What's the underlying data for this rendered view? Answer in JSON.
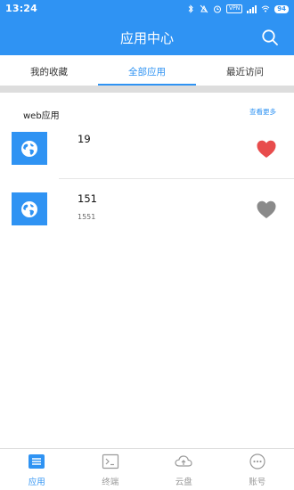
{
  "status_bar": {
    "time": "13:24",
    "vpn": "VPN",
    "battery": "94"
  },
  "header": {
    "title": "应用中心",
    "search_icon": "search-icon"
  },
  "tabs": [
    {
      "label": "我的收藏",
      "active": false
    },
    {
      "label": "全部应用",
      "active": true
    },
    {
      "label": "最近访问",
      "active": false
    }
  ],
  "section": {
    "title": "web应用",
    "more_label": "查看更多"
  },
  "apps": [
    {
      "name": "19",
      "subtitle": "",
      "icon": "globe-icon",
      "favorited": true
    },
    {
      "name": "151",
      "subtitle": "1551",
      "icon": "globe-icon",
      "favorited": false
    }
  ],
  "bottom_nav": [
    {
      "label": "应用",
      "icon": "apps-list-icon",
      "active": true
    },
    {
      "label": "终端",
      "icon": "terminal-icon",
      "active": false
    },
    {
      "label": "云盘",
      "icon": "cloud-upload-icon",
      "active": false
    },
    {
      "label": "账号",
      "icon": "more-dots-icon",
      "active": false
    }
  ],
  "colors": {
    "primary": "#2f93f3",
    "favorite_on": "#e84c4c",
    "favorite_off": "#8a8a8a",
    "nav_inactive": "#999999"
  }
}
